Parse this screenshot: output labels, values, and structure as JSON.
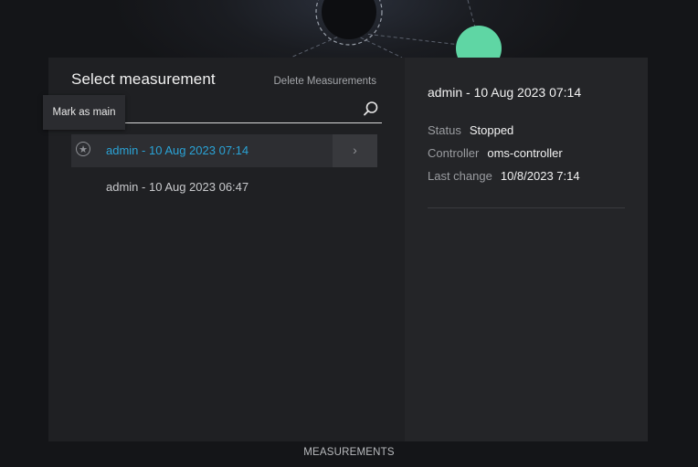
{
  "select_panel": {
    "title": "Select measurement",
    "delete_label": "Delete Measurements",
    "search": {
      "value": "",
      "placeholder": ""
    },
    "tooltip": "Mark as main",
    "rows": [
      {
        "label": "admin - 10 Aug 2023 07:14",
        "selected": true
      },
      {
        "label": "admin - 10 Aug 2023 06:47",
        "selected": false
      }
    ]
  },
  "details": {
    "title": "admin - 10 Aug 2023 07:14",
    "status_label": "Status",
    "status_value": "Stopped",
    "controller_label": "Controller",
    "controller_value": "oms-controller",
    "last_change_label": "Last change",
    "last_change_value": "10/8/2023 7:14"
  },
  "bottom_tab": "MEASUREMENTS",
  "icons": {
    "search": "search-icon",
    "star": "star-icon",
    "chevron": "chevron-right-icon"
  },
  "colors": {
    "accent": "#2aa3d6",
    "node_green": "#5fd6a4"
  }
}
